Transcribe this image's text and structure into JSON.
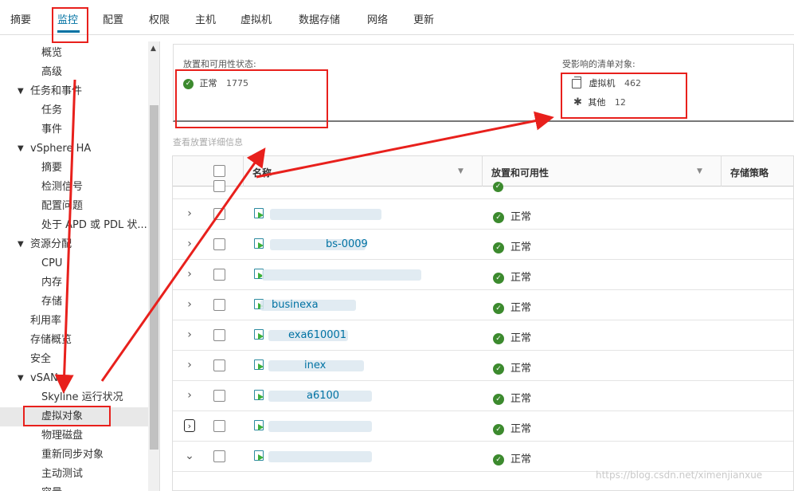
{
  "tabs": [
    "摘要",
    "监控",
    "配置",
    "权限",
    "主机",
    "虚拟机",
    "数据存储",
    "网络",
    "更新"
  ],
  "active_tab": "监控",
  "sidebar": {
    "items": [
      {
        "label": "概览",
        "indent": 2
      },
      {
        "label": "高级",
        "indent": 2
      },
      {
        "label": "任务和事件",
        "indent": 1,
        "caret": "▼"
      },
      {
        "label": "任务",
        "indent": 2
      },
      {
        "label": "事件",
        "indent": 2
      },
      {
        "label": "vSphere HA",
        "indent": 1,
        "caret": "▼"
      },
      {
        "label": "摘要",
        "indent": 2
      },
      {
        "label": "检测信号",
        "indent": 2
      },
      {
        "label": "配置问题",
        "indent": 2
      },
      {
        "label": "处于 APD 或 PDL 状...",
        "indent": 2
      },
      {
        "label": "资源分配",
        "indent": 1,
        "caret": "▼"
      },
      {
        "label": "CPU",
        "indent": 2
      },
      {
        "label": "内存",
        "indent": 2
      },
      {
        "label": "存储",
        "indent": 2
      },
      {
        "label": "利用率",
        "indent": 0
      },
      {
        "label": "存储概览",
        "indent": 0
      },
      {
        "label": "安全",
        "indent": 0
      },
      {
        "label": "vSAN",
        "indent": 1,
        "caret": "▼"
      },
      {
        "label": "Skyline 运行状况",
        "indent": 2
      },
      {
        "label": "虚拟对象",
        "indent": 2,
        "selected": true
      },
      {
        "label": "物理磁盘",
        "indent": 2
      },
      {
        "label": "重新同步对象",
        "indent": 2
      },
      {
        "label": "主动测试",
        "indent": 2
      },
      {
        "label": "容量",
        "indent": 2
      }
    ]
  },
  "summary": {
    "placement_title": "放置和可用性状态:",
    "placement_status": "正常",
    "placement_count": "1775",
    "affected_title": "受影响的清单对象:",
    "vm_label": "虚拟机",
    "vm_count": "462",
    "other_label": "其他",
    "other_count": "12"
  },
  "details_link": "查看放置详细信息",
  "grid": {
    "columns": [
      "名称",
      "放置和可用性",
      "存储策略"
    ],
    "rows": [
      {
        "name": "",
        "status": "正常",
        "expander": "›"
      },
      {
        "name": "bs-0009",
        "status": "正常",
        "expander": "›"
      },
      {
        "name": "",
        "status": "正常",
        "expander": "›"
      },
      {
        "name": "businexa",
        "status": "正常",
        "expander": "›"
      },
      {
        "name": "exa610001",
        "status": "正常",
        "expander": "›"
      },
      {
        "name": "inex",
        "status": "正常",
        "expander": "›"
      },
      {
        "name": "a6100",
        "status": "正常",
        "expander": "›"
      },
      {
        "name": "",
        "status": "正常",
        "expander": "›",
        "boxed": true
      },
      {
        "name": "",
        "status": "正常",
        "expander": "⌄"
      }
    ]
  },
  "watermark": "https://blog.csdn.net/ximenjianxue",
  "colors": {
    "accent": "#0072a3",
    "ok": "#3c8a2e",
    "annotation": "#e8201c"
  }
}
